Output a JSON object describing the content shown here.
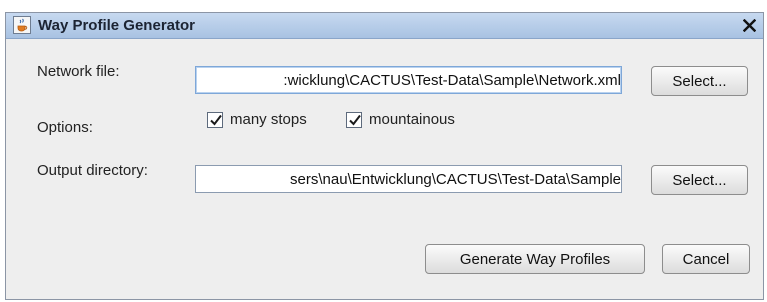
{
  "window": {
    "title": "Way Profile Generator",
    "close_glyph": "✕"
  },
  "network": {
    "label": "Network file:",
    "value": ":wicklung\\CACTUS\\Test-Data\\Sample\\Network.xml",
    "select_label": "Select..."
  },
  "options": {
    "label": "Options:",
    "items": [
      {
        "label": "many stops",
        "checked": true
      },
      {
        "label": "mountainous",
        "checked": true
      }
    ]
  },
  "output": {
    "label": "Output directory:",
    "value": "sers\\nau\\Entwicklung\\CACTUS\\Test-Data\\Sample",
    "select_label": "Select..."
  },
  "actions": {
    "generate_label": "Generate Way Profiles",
    "cancel_label": "Cancel"
  },
  "icons": {
    "app": "java-cup-icon",
    "close": "close-icon",
    "check": "checkmark-icon"
  }
}
